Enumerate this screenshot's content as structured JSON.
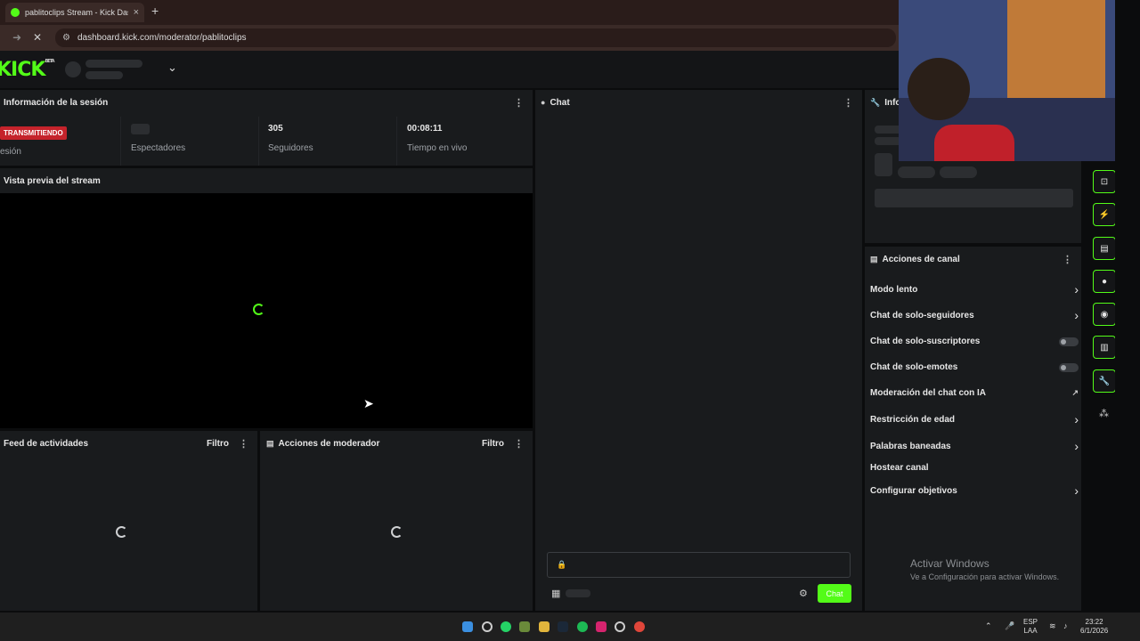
{
  "browser": {
    "tab_title": "pablitoclips Stream - Kick Dashb",
    "tab_close": "×",
    "new_tab": "+",
    "url": "dashboard.kick.com/moderator/pablitoclips"
  },
  "brand": {
    "logo": "KICK",
    "beta": "BETA",
    "accent": "#53fc18"
  },
  "session": {
    "title": "Información de la sesión",
    "status_badge": "TRANSMITIENDO",
    "status_label": "esión",
    "viewers_label": "Espectadores",
    "followers_value": "305",
    "followers_label": "Seguidores",
    "time_value": "00:08:11",
    "time_label": "Tiempo en vivo"
  },
  "preview": {
    "title": "Vista previa del stream"
  },
  "activity": {
    "title": "Feed de actividades",
    "filter": "Filtro"
  },
  "modactions": {
    "title": "Acciones de moderador",
    "filter": "Filtro"
  },
  "chat": {
    "title": "Chat",
    "send_button": "Chat"
  },
  "info": {
    "title": "Info"
  },
  "channel_actions": {
    "title": "Acciones de canal",
    "items": [
      {
        "label": "Modo lento",
        "control": "chevron"
      },
      {
        "label": "Chat de solo-seguidores",
        "control": "chevron"
      },
      {
        "label": "Chat de solo-suscriptores",
        "control": "toggle"
      },
      {
        "label": "Chat de solo-emotes",
        "control": "toggle"
      },
      {
        "label": "Moderación del chat con IA",
        "control": "external"
      },
      {
        "label": "Restricción de edad",
        "control": "chevron"
      },
      {
        "label": "Palabras baneadas",
        "control": "chevron"
      },
      {
        "label": "Hostear canal",
        "control": "none"
      },
      {
        "label": "Configurar objetivos",
        "control": "chevron"
      }
    ]
  },
  "watermark": {
    "line1": "Activar Windows",
    "line2": "Ve a Configuración para activar Windows."
  },
  "taskbar": {
    "lang_top": "ESP",
    "lang_bottom": "LAA",
    "time": "23:22",
    "date": "6/1/2026"
  }
}
